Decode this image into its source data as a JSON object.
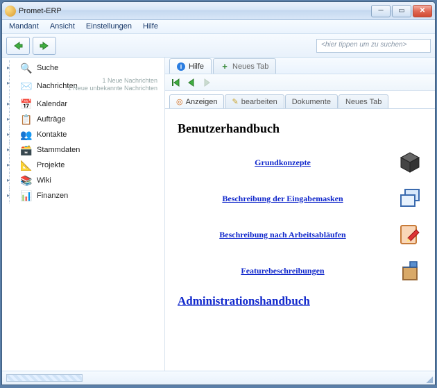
{
  "window": {
    "title": "Promet-ERP"
  },
  "menus": [
    "Mandant",
    "Ansicht",
    "Einstellungen",
    "Hilfe"
  ],
  "search": {
    "placeholder": "<hier tippen um zu suchen>"
  },
  "sidebar": {
    "items": [
      {
        "label": "Suche"
      },
      {
        "label": "Nachrichten",
        "sub1": "1 Neue Nachrichten",
        "sub2": "1 Neue unbekannte Nachrichten"
      },
      {
        "label": "Kalendar"
      },
      {
        "label": "Aufträge"
      },
      {
        "label": "Kontakte"
      },
      {
        "label": "Stammdaten"
      },
      {
        "label": "Projekte"
      },
      {
        "label": "Wiki"
      },
      {
        "label": "Finanzen"
      }
    ]
  },
  "outerTabs": {
    "hilfe": "Hilfe",
    "neu": "Neues Tab"
  },
  "subTabs": [
    "Anzeigen",
    "bearbeiten",
    "Dokumente",
    "Neues Tab"
  ],
  "doc": {
    "h1": "Benutzerhandbuch",
    "links": [
      "Grundkonzepte",
      "Beschreibung der Eingabemasken",
      "Beschreibung nach Arbeitsabläufen",
      "Featurebeschreibungen"
    ],
    "h2": "Administrationshandbuch"
  }
}
